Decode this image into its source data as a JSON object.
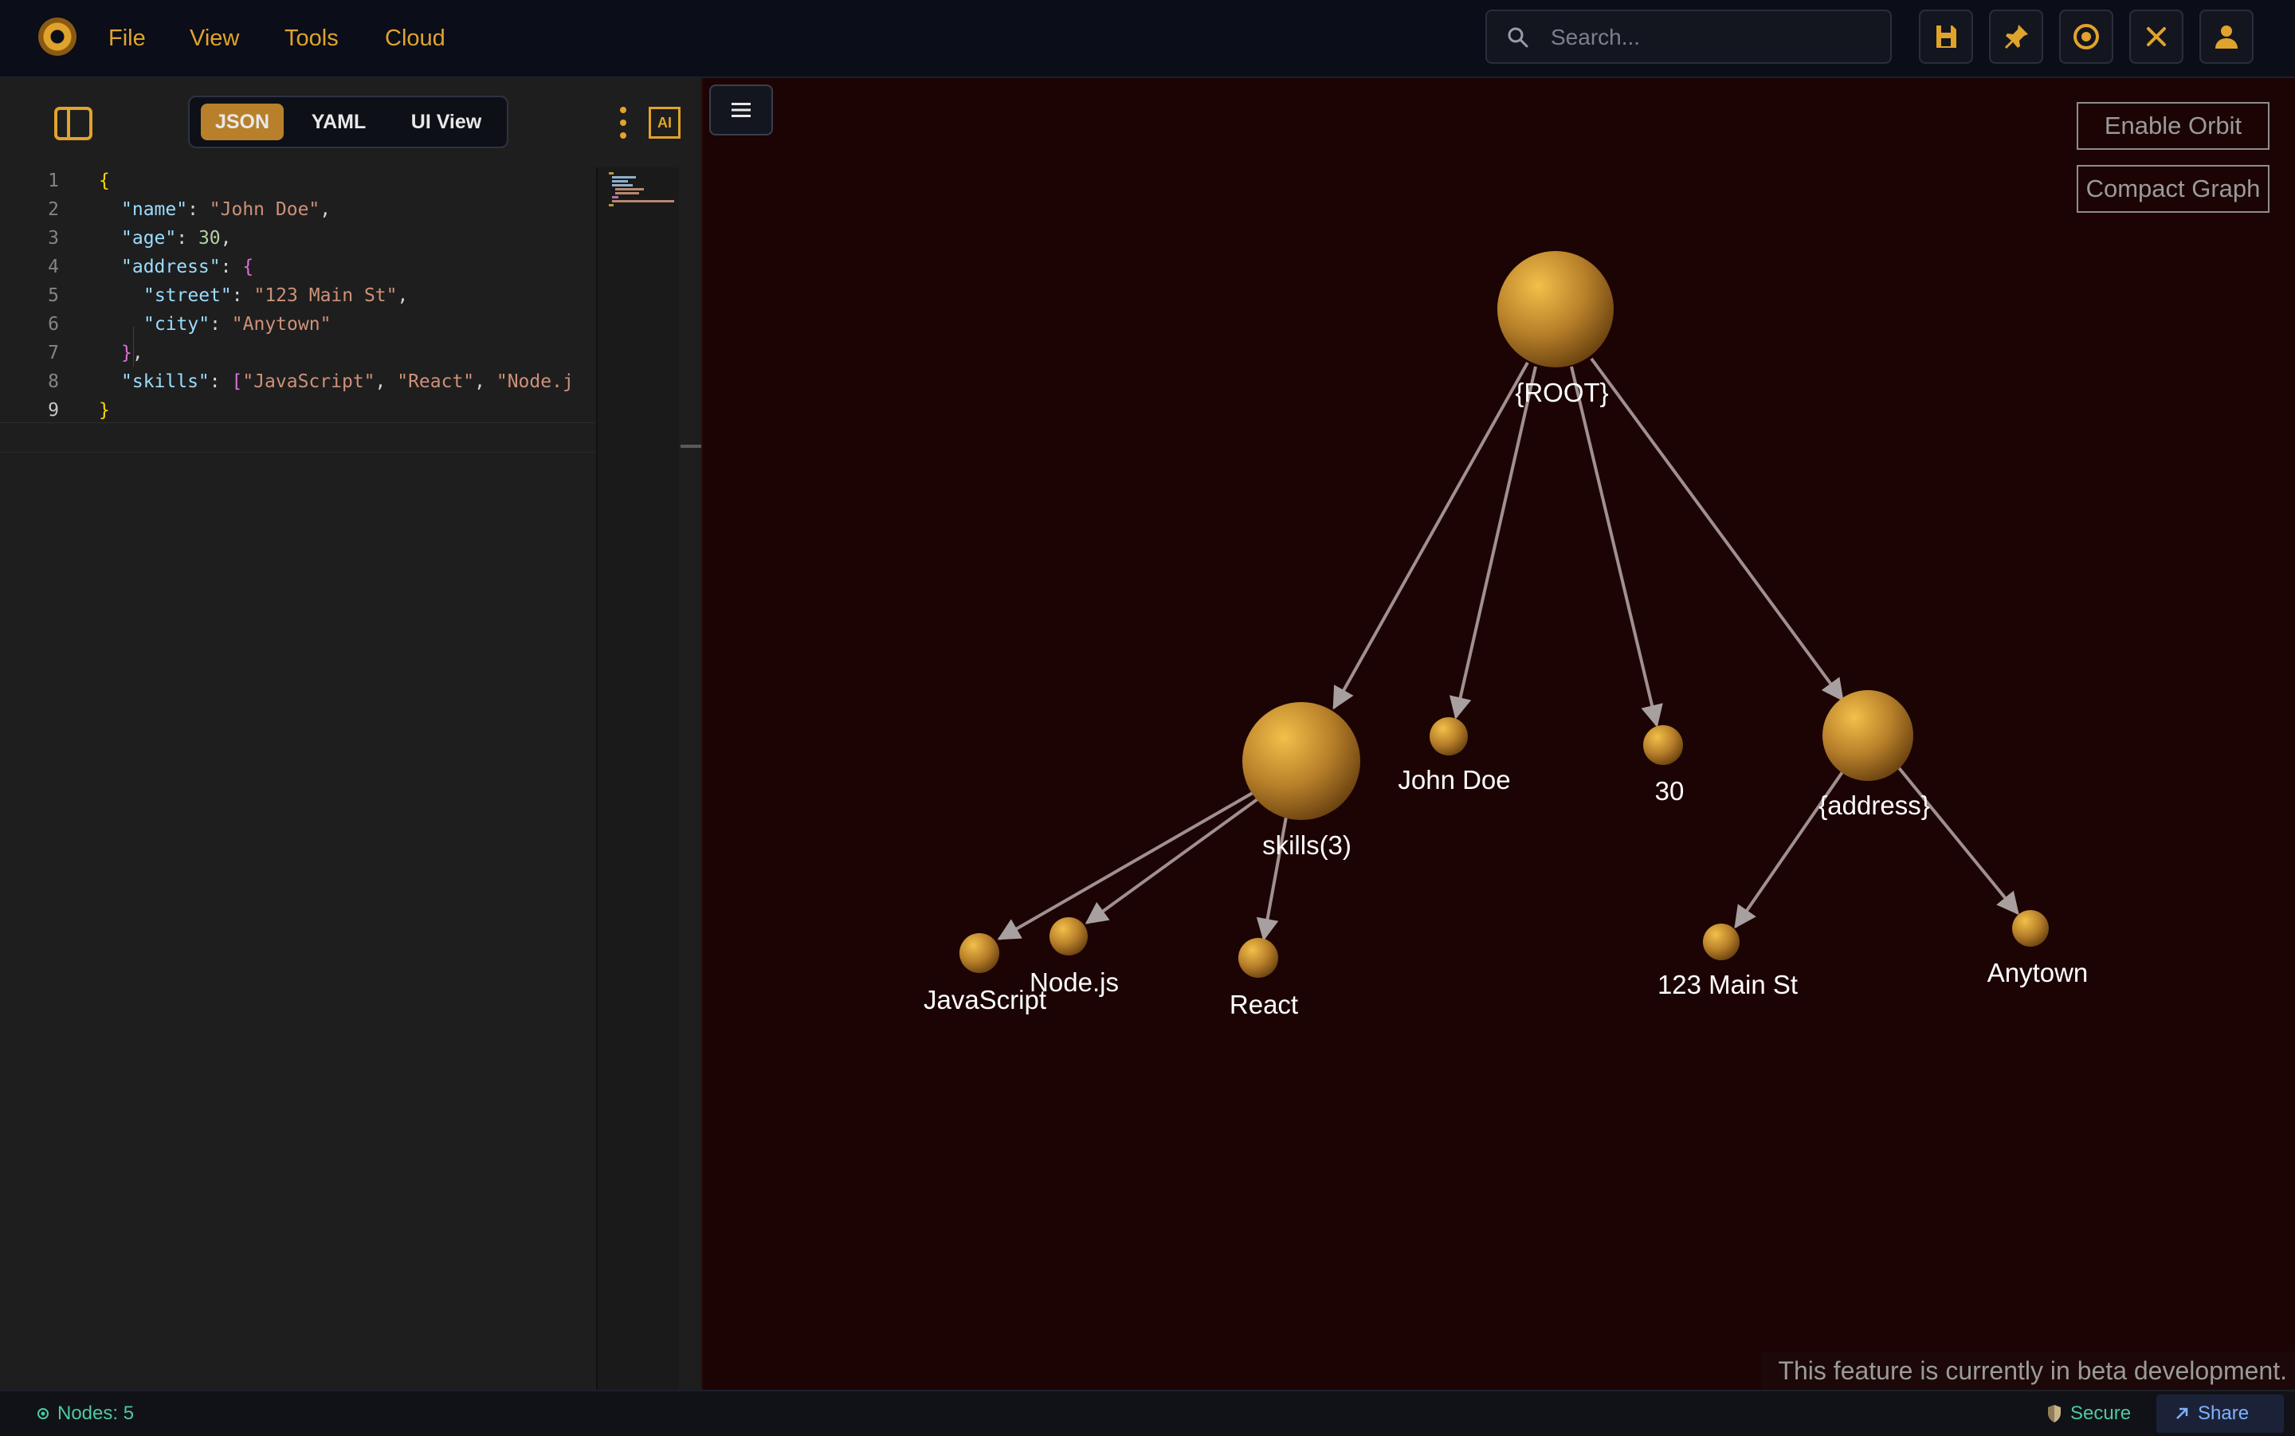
{
  "menubar": {
    "file": "File",
    "view": "View",
    "tools": "Tools",
    "cloud": "Cloud"
  },
  "search": {
    "placeholder": "Search..."
  },
  "toolbar_icons": [
    "save-icon",
    "pin-icon",
    "target-icon",
    "close-icon",
    "user-icon"
  ],
  "editor": {
    "tabs": {
      "json": "JSON",
      "yaml": "YAML",
      "ui_view": "UI View"
    },
    "active_tab": "JSON",
    "ai_badge": "AI",
    "line_numbers": [
      "1",
      "2",
      "3",
      "4",
      "5",
      "6",
      "7",
      "8",
      "9"
    ],
    "lines": {
      "l1": {
        "brace": "{"
      },
      "l2": {
        "key": "\"name\"",
        "value": "\"John Doe\""
      },
      "l3": {
        "key": "\"age\"",
        "value": "30"
      },
      "l4": {
        "key": "\"address\"",
        "brace": "{"
      },
      "l5": {
        "key": "\"street\"",
        "value": "\"123 Main St\""
      },
      "l6": {
        "key": "\"city\"",
        "value": "\"Anytown\""
      },
      "l7": {
        "brace": "}"
      },
      "l8": {
        "key": "\"skills\"",
        "open": "[",
        "v1": "\"JavaScript\"",
        "v2": "\"React\"",
        "v3": "\"Node.j"
      },
      "l9": {
        "brace": "}"
      }
    }
  },
  "graph": {
    "buttons": {
      "orbit": "Enable Orbit",
      "compact": "Compact Graph"
    },
    "nodes": {
      "root": "{ROOT}",
      "skills": "skills(3)",
      "name": "John Doe",
      "age": "30",
      "address": "{address}",
      "js": "JavaScript",
      "node": "Node.js",
      "react": "React",
      "street": "123 Main St",
      "city": "Anytown"
    },
    "beta_notice": "This feature is currently in beta development."
  },
  "statusbar": {
    "nodes": "Nodes: 5",
    "secure": "Secure",
    "share": "Share"
  },
  "colors": {
    "accent": "#e0a32c",
    "node": "#b8802a",
    "graph_bg": "#1c0404",
    "edge": "#a09090"
  }
}
